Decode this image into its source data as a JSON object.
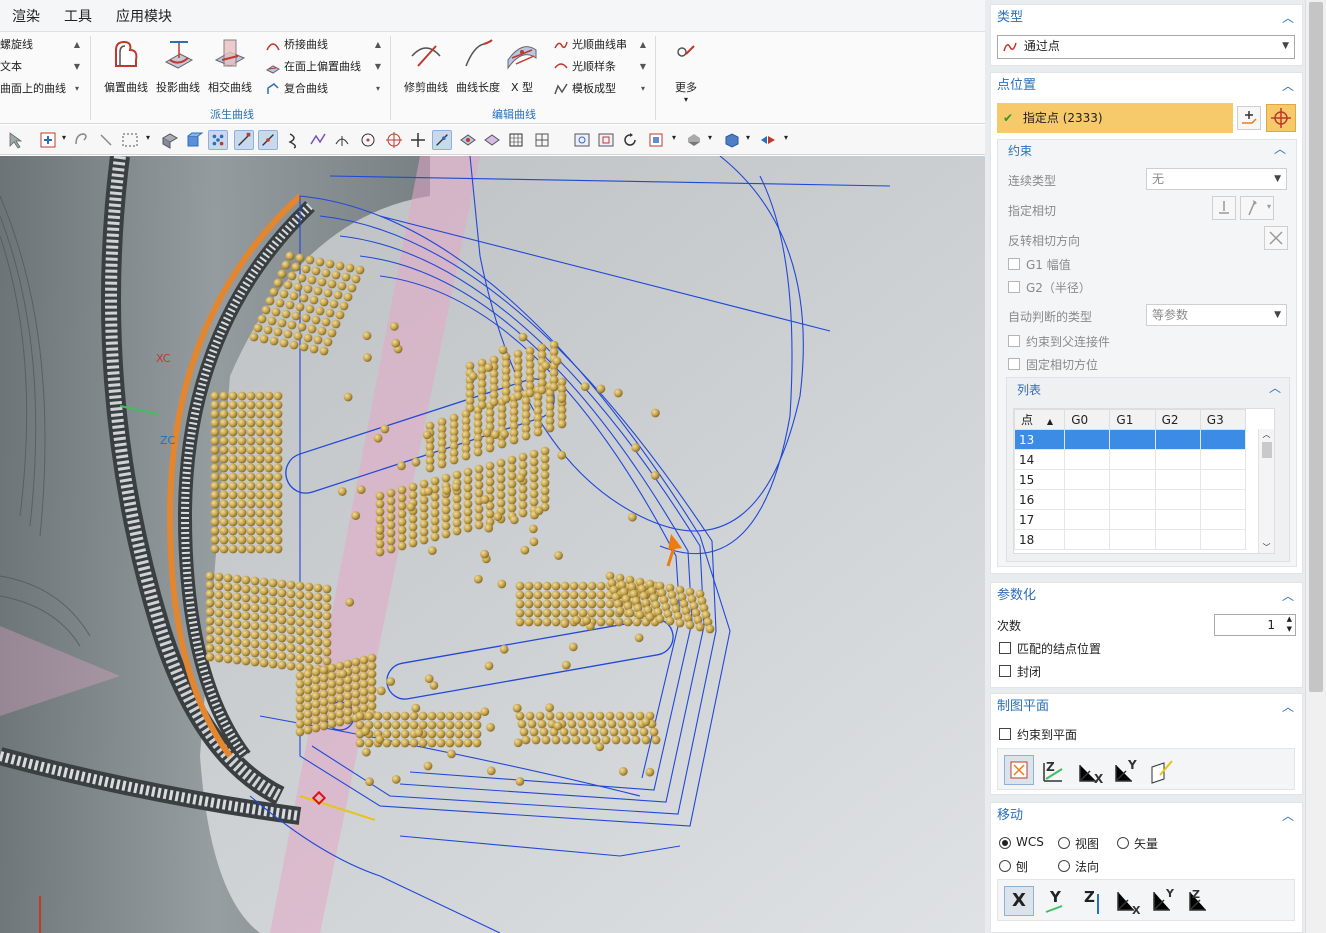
{
  "menu": {
    "items": [
      "渲染",
      "工具",
      "应用模块"
    ]
  },
  "ribbon": {
    "left_list": [
      "螺旋线",
      "文本",
      "曲面上的曲线"
    ],
    "derived_group": {
      "label": "派生曲线",
      "big_buttons": [
        "偏置曲线",
        "投影曲线",
        "相交曲线"
      ],
      "list": [
        "桥接曲线",
        "在面上偏置曲线",
        "复合曲线"
      ]
    },
    "edit_group": {
      "label": "编辑曲线",
      "big_buttons": [
        "修剪曲线",
        "曲线长度",
        "X 型"
      ],
      "list": [
        "光顺曲线串",
        "光顺样条",
        "模板成型"
      ]
    },
    "more_label": "更多"
  },
  "viewport": {
    "axis_labels": [
      "XC",
      "ZC"
    ]
  },
  "panel": {
    "type_section": {
      "title": "类型",
      "value": "通过点"
    },
    "point_section": {
      "title": "点位置",
      "specify_point": "指定点 (2333)",
      "constraint": {
        "title": "约束",
        "continuity_type_label": "连续类型",
        "continuity_type_value": "无",
        "specify_tangent_label": "指定相切",
        "reverse_tangent_label": "反转相切方向",
        "g1_label": "G1 幅值",
        "g2_label": "G2（半径）",
        "auto_type_label": "自动判断的类型",
        "auto_type_value": "等参数",
        "constrain_parent_label": "约束到父连接件",
        "fix_tangent_label": "固定相切方位"
      },
      "list": {
        "title": "列表",
        "columns": [
          "点",
          "G0",
          "G1",
          "G2",
          "G3"
        ],
        "rows": [
          "13",
          "14",
          "15",
          "16",
          "17",
          "18"
        ],
        "selected_row": "13"
      }
    },
    "param_section": {
      "title": "参数化",
      "degree_label": "次数",
      "degree_value": "1",
      "match_knots_label": "匹配的结点位置",
      "closed_label": "封闭"
    },
    "drawing_plane_section": {
      "title": "制图平面",
      "constrain_plane_label": "约束到平面"
    },
    "move_section": {
      "title": "移动",
      "options": [
        "WCS",
        "视图",
        "矢量",
        "刨",
        "法向"
      ],
      "selected": "WCS",
      "axis_buttons": [
        "X",
        "Y",
        "Z"
      ]
    }
  },
  "colors": {
    "accent": "#2a6fb8",
    "selected_row": "#3c8be4",
    "specify_point_bg": "#f6c96a",
    "bead": "#c6a54f",
    "viewport_bg": "#c9cdd0"
  }
}
